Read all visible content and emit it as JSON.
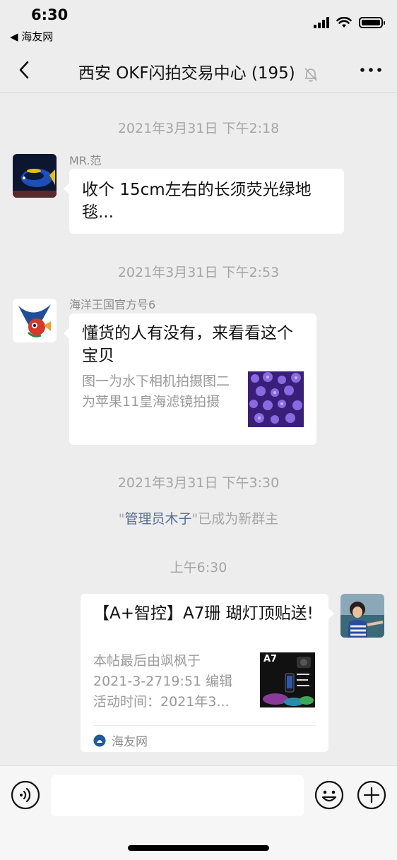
{
  "status_bar": {
    "time": "6:30",
    "back_app": "◀ 海友网"
  },
  "nav": {
    "title": "西安 OKF闪拍交易中心 (195)",
    "back_icon": "chevron-left-icon",
    "mute_icon": "bell-off-icon",
    "more_icon": "more-icon"
  },
  "messages": {
    "ts1": "2021年3月31日 下午2:18",
    "m1": {
      "sender": "MR.范",
      "text": "收个 15cm左右的长须荧光绿地毯..."
    },
    "ts2": "2021年3月31日 下午2:53",
    "m2": {
      "sender": "海洋王国官方号6",
      "title": "懂货的人有没有，来看看这个宝贝",
      "desc": "图一为水下相机拍摄图二为苹果11皇海滤镜拍摄"
    },
    "ts3": "2021年3月31日 下午3:30",
    "sys": {
      "quote_open": "\"",
      "name": "管理员木子",
      "rest": "\"已成为新群主"
    },
    "ts4": "上午6:30",
    "m3": {
      "title": "【A+智控】A7珊 瑚灯顶贴送!",
      "desc_line1": "本帖最后由飒枫于",
      "desc_line2": "2021-3-2719:51 编辑",
      "desc_line3": "活动时间：2021年3...",
      "thumb_label": "A7",
      "source": "海友网"
    }
  },
  "input_bar": {
    "voice_icon": "voice-icon",
    "emoji_icon": "emoji-icon",
    "plus_icon": "plus-icon",
    "input_value": ""
  },
  "colors": {
    "background": "#ededed",
    "bubble": "#ffffff",
    "link": "#576b95",
    "timestamp": "#a5a5a5"
  }
}
